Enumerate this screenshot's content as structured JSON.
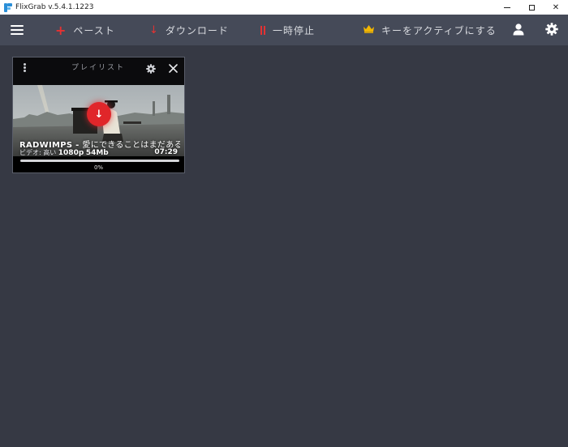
{
  "window": {
    "title": "FlixGrab  v.5.4.1.1223",
    "minimize_glyph": "",
    "maximize_glyph": "",
    "close_glyph": "✕"
  },
  "toolbar": {
    "paste_label": "ペースト",
    "download_label": "ダウンロード",
    "pause_label": "一時停止",
    "activate_label": "キーをアクティブにする",
    "icons": {
      "menu": "hamburger-icon",
      "paste": "plus-icon",
      "download": "arrow-down-icon",
      "pause": "pause-icon",
      "activate": "crown-icon",
      "account": "user-icon",
      "settings": "gear-icon"
    },
    "colors": {
      "accent": "#e53232",
      "crown": "#f2b600"
    }
  },
  "card": {
    "header_label": "プレイリスト",
    "title_artist": "RADWIMPS - ",
    "title_song": "愛にできることはまだあるかい",
    "meta_prefix": "ビデオ: 高い ",
    "meta_quality": "1080p",
    "meta_size": "54Mb",
    "duration": "07:29",
    "progress_percent": 0,
    "progress_text": "0%"
  }
}
